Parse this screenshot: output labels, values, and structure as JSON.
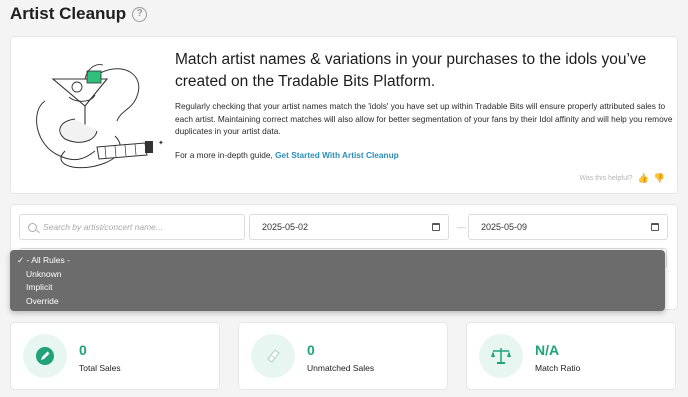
{
  "page": {
    "title": "Artist Cleanup",
    "help_glyph": "?"
  },
  "info": {
    "headline": "Match artist names & variations in your purchases to the idols you’ve created on the Tradable Bits Platform.",
    "body": "Regularly checking that your artist names match the 'idols' you have set up within Tradable Bits will ensure properly attributed sales to each artist. Maintaining correct matches will also allow for better segmentation of your fans by their Idol affinity and will help you remove duplicates in your artist data.",
    "guide_prefix": "For a more in-depth guide,",
    "guide_link": "Get Started With Artist Cleanup",
    "helpful_text": "Was this helpful?",
    "thumbs_up": "👍",
    "thumbs_down": "👎"
  },
  "filters": {
    "search_placeholder": "Search by artist/concert name...",
    "date_from": "2025-05-02",
    "date_to": "2025-05-09",
    "date_separator": "—",
    "rule_options": [
      "- All Rules -",
      "Unknown",
      "Implicit",
      "Override"
    ],
    "selected_rule": "- All Rules -",
    "check_mark": "✓"
  },
  "stats": [
    {
      "value": "0",
      "label": "Total Sales",
      "icon": "pencil-icon"
    },
    {
      "value": "0",
      "label": "Unmatched Sales",
      "icon": "eraser-icon"
    },
    {
      "value": "N/A",
      "label": "Match Ratio",
      "icon": "scale-icon"
    }
  ],
  "colors": {
    "accent_green": "#1fa37a",
    "link_blue": "#2a8fb8",
    "icon_bg": "#e8f6f1",
    "dropdown_bg": "#6c6c6c"
  }
}
